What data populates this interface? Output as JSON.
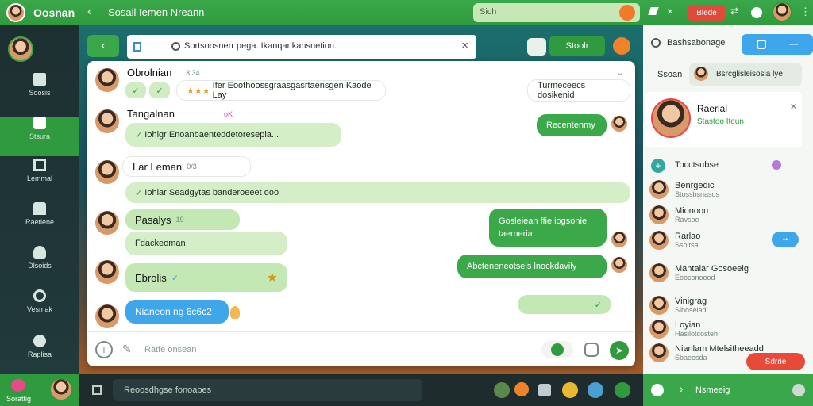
{
  "app": {
    "title": "Oosnan"
  },
  "topbar": {
    "title": "Sosail Iemen Nreann",
    "search_text": "Sich",
    "action_label": "Blede"
  },
  "nav": {
    "items": [
      {
        "label": "Soosis"
      },
      {
        "label": "Stsura"
      },
      {
        "label": "Lemmal"
      },
      {
        "label": "Raetiene"
      },
      {
        "label": "Dlsoids"
      },
      {
        "label": "Vesmak"
      },
      {
        "label": "Raplisa"
      }
    ],
    "footer_label": "Sorattig"
  },
  "chat": {
    "search_placeholder": "Sortsoosnerr pega. Ikanqankansnetion.",
    "top_button": "Stoolr",
    "composer_placeholder": "Ratfe onsean",
    "messages": [
      {
        "sender": "Obrolnian",
        "time": "3:34",
        "text": "Ifer Eoothoossgraasgasrtaensgen Kaode Lay"
      },
      {
        "sender": "Tangalnan",
        "time": "oK",
        "text": "Iohigr Enoanbaenteddetoresepia..."
      },
      {
        "sender": "Lar Leman",
        "time": "0/3",
        "text": "Iohiar Seadgytas banderoeeet ooo"
      },
      {
        "sender": "Pasalys",
        "time": "19",
        "text": "Fdackeoman"
      },
      {
        "sender": "Ebrolis",
        "time": "",
        "text": ""
      },
      {
        "sender": "",
        "time": "",
        "text": "Nianeon ng 6c6c2"
      }
    ],
    "outgoing": [
      {
        "text": "Turmeceecs dosikenid"
      },
      {
        "text": "Recentenmy"
      },
      {
        "text": "Gosleiean ffie iogsonie taemeria"
      },
      {
        "text": "Abcteneneotsels lnockdavily"
      }
    ]
  },
  "sidebar": {
    "header_title": "Bashsabonage",
    "filter_label": "Ssoan",
    "filter_value": "Bsrcglisleisosia lye",
    "profile_name": "Raerlal",
    "profile_status": "Stastoo Iteun",
    "section_title": "Tocctsubse",
    "contacts": [
      {
        "name": "Benrgedic",
        "sub": "Stossbsnasos"
      },
      {
        "name": "Mionoou",
        "sub": "Ravsoe"
      },
      {
        "name": "Rarlao",
        "sub": "Ssoitsa"
      },
      {
        "name": "Mantalar Gosoeelg",
        "sub": "Eooconoood"
      },
      {
        "name": "Vinigrag",
        "sub": "Siboselad"
      },
      {
        "name": "Loyian",
        "sub": "Hasilotcosteh"
      },
      {
        "name": "Nianlam Mtelsitheeadd",
        "sub": "Sbaeesda"
      }
    ],
    "reply_button": "Sdrrie",
    "footer_label": "Nsmeeig"
  },
  "bottom": {
    "status_text": "Reoosdhgse fonoabes"
  },
  "colors": {
    "brand_green": "#2f9a3e",
    "accent_blue": "#3ea6ea",
    "alert_red": "#e74c3c"
  }
}
